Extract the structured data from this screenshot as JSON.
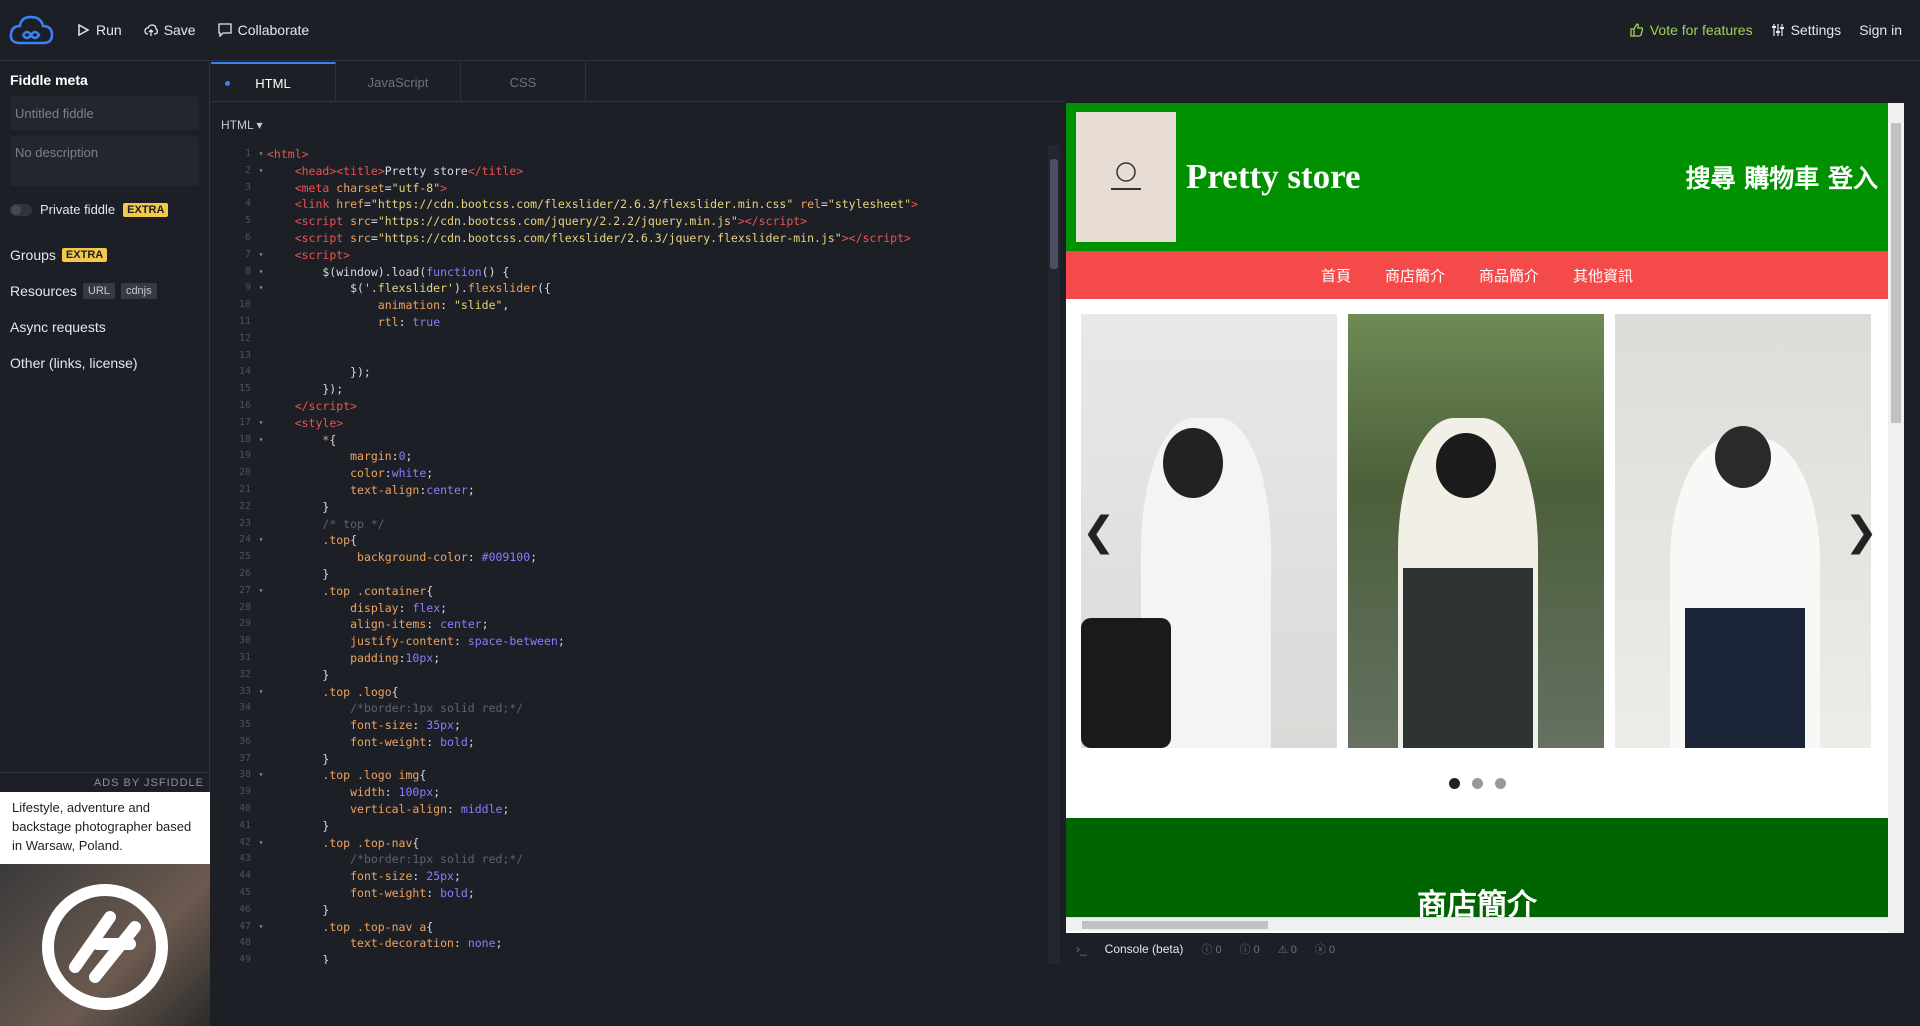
{
  "topbar": {
    "run": "Run",
    "save": "Save",
    "collaborate": "Collaborate",
    "vote": "Vote for features",
    "settings": "Settings",
    "signin": "Sign in"
  },
  "sidebar": {
    "title": "Fiddle meta",
    "title_placeholder": "Untitled fiddle",
    "description_placeholder": "No description",
    "private_label": "Private fiddle",
    "extra_badge": "EXTRA",
    "groups": "Groups",
    "resources": "Resources",
    "url_tag": "URL",
    "cdnjs_tag": "cdnjs",
    "async": "Async requests",
    "other": "Other (links, license)",
    "ads_label": "ADS BY JSFIDDLE",
    "ads_text": "Lifestyle, adventure and backstage photographer based in Warsaw, Poland."
  },
  "editor": {
    "tabs": [
      "HTML",
      "JavaScript",
      "CSS"
    ],
    "lang": "HTML ▾"
  },
  "preview": {
    "title": "Pretty store",
    "topnav": "搜尋 購物車 登入",
    "nav": [
      "首頁",
      "商店簡介",
      "商品簡介",
      "其他資訊"
    ],
    "section": "商店簡介",
    "prev": "❮",
    "next": "❯"
  },
  "console": {
    "label": "Console (beta)",
    "counts": [
      "0",
      "0",
      "0",
      "0"
    ]
  },
  "colors": {
    "top_green": "#009100",
    "nav_red": "#f54a4a",
    "accent_blue": "#3b82f6",
    "vote_green": "#9fd356"
  }
}
